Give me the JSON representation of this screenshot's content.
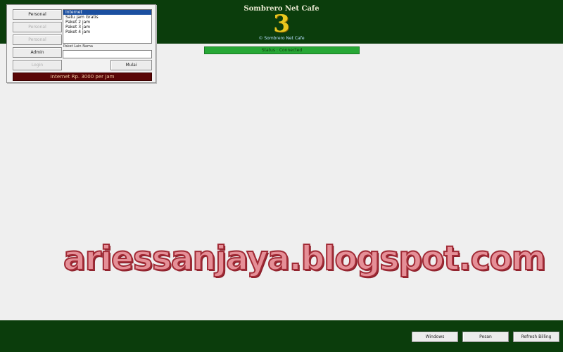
{
  "header": {
    "title": "Sombrero Net Cafe",
    "number": "3",
    "subtitle": "© Sombrero Net Cafe"
  },
  "status": {
    "text": "Status : Connected",
    "color": "#27a836"
  },
  "panel": {
    "buttons": [
      {
        "label": "Personal",
        "enabled": true
      },
      {
        "label": "Personal",
        "enabled": false
      },
      {
        "label": "Personal",
        "enabled": false
      },
      {
        "label": "Admin",
        "enabled": true
      },
      {
        "label": "Login",
        "enabled": false
      }
    ],
    "packages": [
      "Internet",
      "Satu Jam Gratis",
      "Paket 2 jam",
      "Paket 3 jam",
      "Paket 4 jam"
    ],
    "selected_index": 0,
    "field_label": "Paket Lain Nama",
    "field_value": "",
    "go_button": "Mulai",
    "price_banner": "Internet Rp. 3000 per Jam"
  },
  "footer": {
    "buttons": [
      "Windows",
      "Pesan",
      "Refresh Billing"
    ]
  },
  "watermark": "ariessanjaya.blogspot.com",
  "colors": {
    "band": "#0b3d0c",
    "content": "#efefef",
    "banner": "#5a0606"
  }
}
